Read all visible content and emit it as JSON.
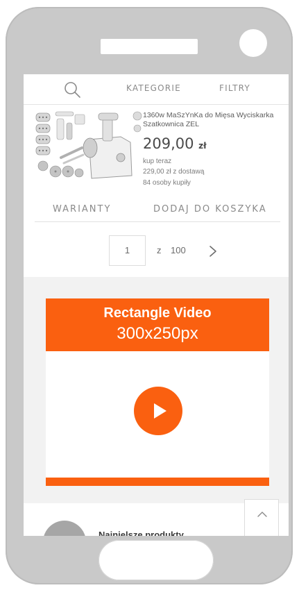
{
  "nav": {
    "categories_label": "KATEGORIE",
    "filters_label": "FILTRY"
  },
  "product": {
    "title": "1360w MaSzYnKa do Mięsa Wyciskarka Szatkownica ZEL",
    "price_value": "209,00",
    "price_currency": "zł",
    "buy_label": "kup teraz",
    "delivery_label": "229,00 zł z dostawą",
    "sold_label": "84 osoby kupiły"
  },
  "actions": {
    "variants_label": "WARIANTY",
    "add_to_cart_label": "DODAJ DO KOSZYKA"
  },
  "pagination": {
    "current_page": "1",
    "of_label": "z",
    "total_pages": "100"
  },
  "ad": {
    "title": "Rectangle Video",
    "size": "300x250px",
    "accent_color": "#fa6010"
  },
  "section": {
    "label": "Najnielsze produkty"
  },
  "icons": [
    "search-icon",
    "chevron-right-icon",
    "play-icon",
    "chevron-up-icon"
  ]
}
